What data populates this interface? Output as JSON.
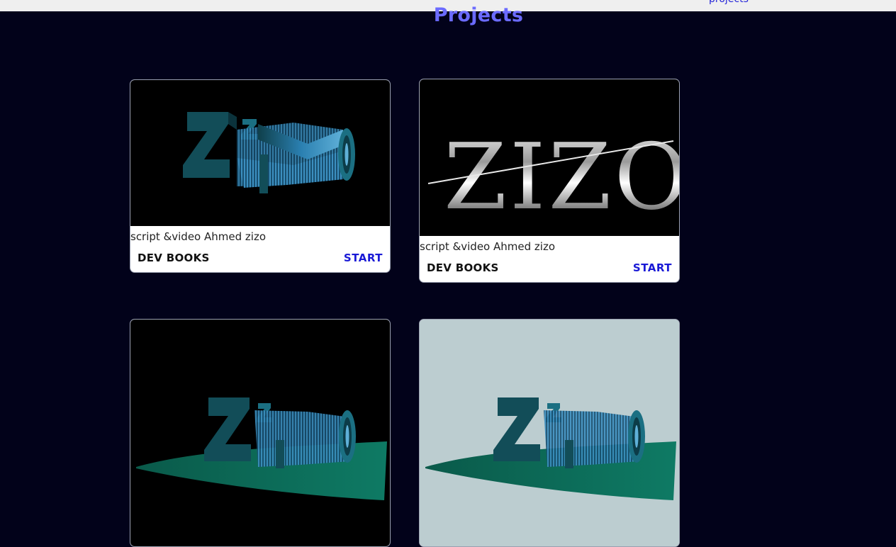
{
  "header": {
    "nav_link": "projects",
    "section_title": "Projects"
  },
  "projects": [
    {
      "image": "zizo-3d-logo-dark",
      "description": "script &video Ahmed zizo",
      "brand": "DEV BOOKS",
      "action": "START"
    },
    {
      "image": "zizo-chrome-logo",
      "logo_text": "ZIZO",
      "description": "script &video Ahmed zizo",
      "brand": "DEV BOOKS",
      "action": "START"
    },
    {
      "image": "zizo-3d-logo-wave-dark"
    },
    {
      "image": "zizo-3d-logo-wave-light"
    }
  ],
  "colors": {
    "background": "#02021a",
    "title": "#6b6bff",
    "action": "#1a1ad6",
    "logo_teal": "#124d58",
    "logo_blue": "#2a7fb0",
    "wave_green": "#0c6b5a"
  }
}
